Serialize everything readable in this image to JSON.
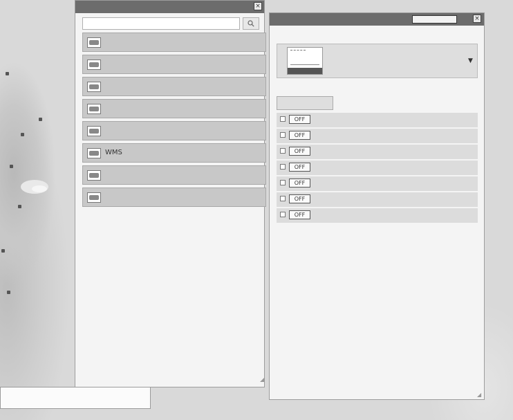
{
  "copyright": {
    "line1": "",
    "line2": ""
  },
  "left_panel": {
    "title": "",
    "search_placeholder": "",
    "layers": [
      {
        "label": ""
      },
      {
        "label": ""
      },
      {
        "label": ""
      },
      {
        "label": ""
      },
      {
        "label": ""
      },
      {
        "label": "WMS"
      },
      {
        "label": ""
      },
      {
        "label": ""
      }
    ]
  },
  "right_panel": {
    "title": "",
    "header_button": "",
    "basemap_section_label": "",
    "basemap_text": "",
    "sort_button": "",
    "list_note": "",
    "toggle_label": "OFF",
    "active_layers": [
      {
        "label": ""
      },
      {
        "label": ""
      },
      {
        "label": ""
      },
      {
        "label": ""
      },
      {
        "label": ""
      },
      {
        "label": ""
      },
      {
        "label": ""
      }
    ],
    "footnote": ""
  },
  "icons": {
    "close": "close-icon",
    "search": "search-icon",
    "layer": "layer-icon",
    "dropdown": "chevron-down-icon",
    "resize": "resize-grip-icon"
  }
}
